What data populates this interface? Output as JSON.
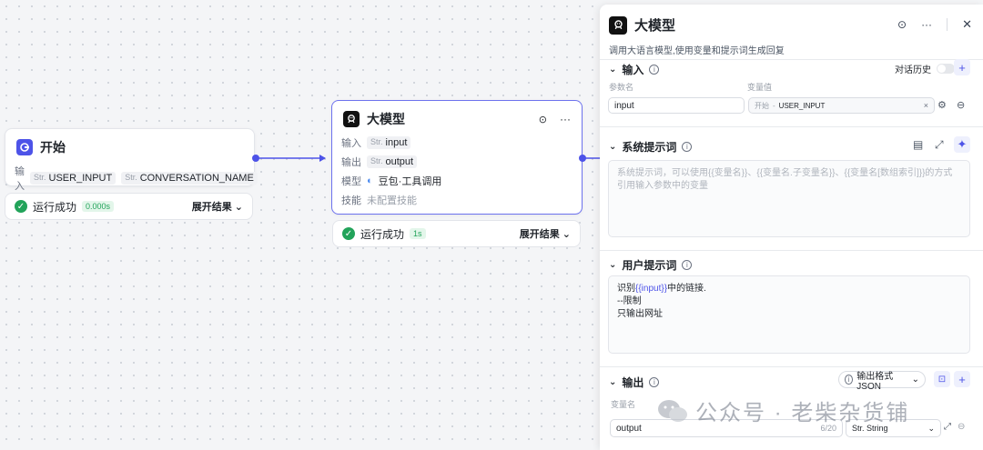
{
  "start_node": {
    "title": "开始",
    "input_label": "输入",
    "inputs": [
      {
        "type": "Str.",
        "name": "USER_INPUT"
      },
      {
        "type": "Str.",
        "name": "CONVERSATION_NAME"
      }
    ],
    "status_text": "运行成功",
    "time": "0.000s",
    "expand_label": "展开结果"
  },
  "llm_node": {
    "title": "大模型",
    "input_label": "输入",
    "input_type": "Str.",
    "input_value": "input",
    "output_label": "输出",
    "output_type": "Str.",
    "output_value": "output",
    "model_label": "模型",
    "model_value": "豆包·工具调用",
    "skill_label": "技能",
    "skill_value": "未配置技能",
    "status_text": "运行成功",
    "time": "1s",
    "expand_label": "展开结果"
  },
  "panel": {
    "title": "大模型",
    "subtitle": "调用大语言模型,使用变量和提示词生成回复",
    "input_section": {
      "title": "输入",
      "history_label": "对话历史",
      "history_enabled": false,
      "param_header": "参数名",
      "value_header": "变量值",
      "param_value": "input",
      "var_source": "开始",
      "var_name": "USER_INPUT"
    },
    "system_prompt": {
      "title": "系统提示词",
      "placeholder": "系统提示词，可以使用{{变量名}}、{{变量名.子变量名}}、{{变量名[数组索引]}}的方式引用输入参数中的变量"
    },
    "user_prompt": {
      "title": "用户提示词",
      "line1_prefix": "识别",
      "line1_var": "{{input}}",
      "line1_suffix": "中的链接.",
      "line2": "--限制",
      "line3": "只输出网址"
    },
    "output_section": {
      "title": "输出",
      "format_label": "输出格式 JSON",
      "var_header": "变量名",
      "var_value": "output",
      "counter": "6/20",
      "type_value": "Str. String"
    }
  },
  "watermark": "公众号 · 老柴杂货铺",
  "colors": {
    "accent": "#4d53e8",
    "success": "#22a35a"
  }
}
